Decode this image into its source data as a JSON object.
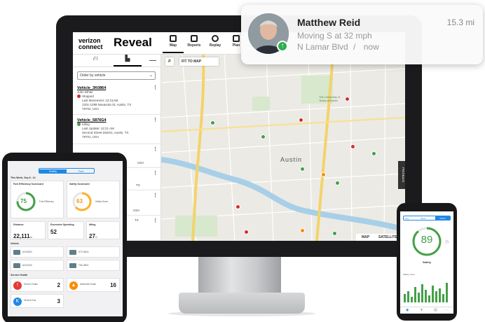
{
  "app": {
    "brand_line1": "verizon",
    "brand_line2": "connect",
    "product": "Reveal",
    "nav": [
      {
        "label": "Map",
        "icon": "map-icon",
        "active": true
      },
      {
        "label": "Reports",
        "icon": "reports-icon",
        "active": false
      },
      {
        "label": "Replay",
        "icon": "replay-icon",
        "active": false
      },
      {
        "label": "Plan",
        "icon": "plan-icon",
        "active": false
      }
    ]
  },
  "sidebar": {
    "order_select": "Order by vehicle",
    "vehicles": [
      {
        "name": "Vehicle_3K0864",
        "driver": "John White",
        "status": "Stopped",
        "status_color": "#d32f2f",
        "time": "Last Movement: 12:21AM",
        "address": "1201-1299 Navasota St, Austin, TX 78702, USA"
      },
      {
        "name": "Vehicle_5876G4",
        "driver": "Idling",
        "status": "",
        "status_color": "#43a047",
        "time": "Last Update: 12:21 AM",
        "address": "Second Street District, Austin, TX 78701, USA"
      }
    ],
    "fragments": [
      "USA",
      "TX",
      "USA",
      "TX"
    ]
  },
  "map": {
    "fit_label": "FIT TO MAP",
    "map_label": "MAP",
    "satellite_label": "SATELLITE",
    "feedback_label": "FEEDBACK",
    "city_label": "Austin",
    "campus_label": "The University of Texas at Austin"
  },
  "notification": {
    "name": "Matthew Reid",
    "distance": "15.3 mi",
    "status": "Moving S at 32 mph",
    "location": "N Lamar Blvd",
    "separator": "/",
    "time": "now"
  },
  "tablet": {
    "tab_a": "Safety",
    "tab_b": "Fuel",
    "period": "This Week, Sep 8 - 14",
    "fuel_card": {
      "title": "Fuel Efficiency Scorecard",
      "score": "75",
      "label": "Fuel Efficiency"
    },
    "safety_card": {
      "title": "Safety Scorecard",
      "score": "63",
      "label": "Safety Score"
    },
    "distance": {
      "title": "Distance",
      "value": "22,111",
      "unit": "mi"
    },
    "speeding": {
      "title": "Excessive Speeding",
      "value": "52"
    },
    "idling": {
      "title": "Idling",
      "value": "27",
      "unit": "%"
    },
    "vehicles_title": "Vehicle",
    "vehicles": [
      "All 3X820",
      "NTX 8843",
      "All 3X430",
      "TML 8803"
    ],
    "service_title": "Service Health",
    "services": [
      {
        "label": "Severe Faults",
        "value": "2",
        "color": "#e53935"
      },
      {
        "label": "Moderate Faults",
        "value": "16",
        "color": "#fb8c00"
      },
      {
        "label": "Service Due",
        "value": "3",
        "color": "#1e88e5"
      }
    ]
  },
  "phone": {
    "tabs": [
      "Day",
      "Week",
      "Month"
    ],
    "score": "89",
    "label": "Safety",
    "chart_title": "Safety score"
  }
}
